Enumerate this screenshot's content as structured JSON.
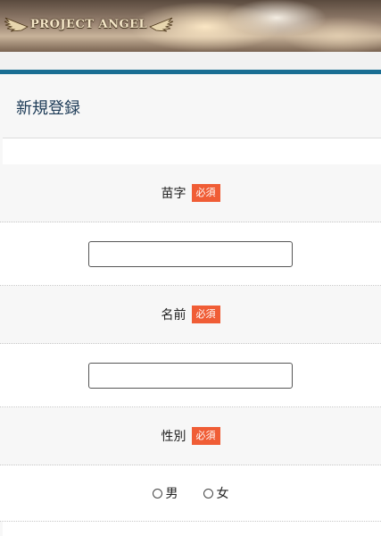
{
  "header": {
    "logo_text": "PROJECT ANGEL",
    "logo_icon": "angel-wing-icon"
  },
  "page": {
    "title": "新規登録"
  },
  "form": {
    "required_badge": "必須",
    "last_name": {
      "label": "苗字",
      "value": ""
    },
    "first_name": {
      "label": "名前",
      "value": ""
    },
    "gender": {
      "label": "性別",
      "options": [
        "男",
        "女"
      ]
    }
  },
  "colors": {
    "accent_bar": "#1a6e93",
    "required_badge": "#f05d36",
    "title_text": "#1d3b57"
  }
}
